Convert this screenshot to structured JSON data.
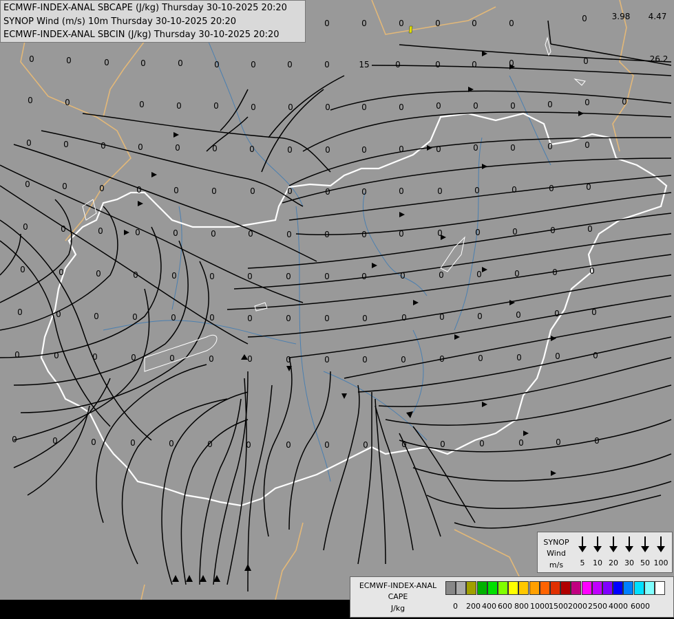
{
  "titles": {
    "line1": "ECMWF-INDEX-ANAL SBCAPE (J/kg) Thursday 30-10-2025 20:20",
    "line2": "SYNOP Wind (m/s) 10m Thursday 30-10-2025 20:20",
    "line3": "ECMWF-INDEX-ANAL SBCIN (J/kg) Thursday 30-10-2025 20:20"
  },
  "synop_legend": {
    "title1": "SYNOP",
    "title2": "Wind",
    "title3": "m/s",
    "values": [
      "5",
      "10",
      "20",
      "30",
      "50",
      "100"
    ]
  },
  "cape_legend": {
    "title1": "ECMWF-INDEX-ANAL",
    "title2": "CAPE",
    "title3": "J/kg",
    "ticks": [
      "0",
      "200",
      "400",
      "600",
      "800",
      "1000",
      "1500",
      "2000",
      "2500",
      "4000",
      "6000"
    ],
    "colors": [
      "#888888",
      "#aaaaaa",
      "#a0a000",
      "#00b000",
      "#00e000",
      "#80ff00",
      "#ffff00",
      "#ffc800",
      "#ffa000",
      "#ff6400",
      "#e03000",
      "#b00000",
      "#c00080",
      "#ff00ff",
      "#c000ff",
      "#8000ff",
      "#0000ff",
      "#0080ff",
      "#00e0ff",
      "#80ffff",
      "#ffffff"
    ]
  },
  "map_values": [
    "0",
    "0",
    "0",
    "0",
    "0",
    "0",
    "0",
    "3.98",
    "4.47",
    "0",
    "0",
    "0",
    "0",
    "0",
    "0",
    "0",
    "0",
    "0",
    "15",
    "0",
    "0",
    "0",
    "0",
    "0",
    "26.2",
    "0",
    "0",
    "0",
    "0",
    "0",
    "0",
    "0",
    "0",
    "0",
    "0",
    "0",
    "0",
    "0",
    "0",
    "0",
    "0",
    "0",
    "0",
    "0",
    "0",
    "0",
    "0",
    "0",
    "0",
    "0",
    "0",
    "0",
    "0",
    "0",
    "0",
    "0",
    "0",
    "0",
    "0",
    "0",
    "0",
    "0",
    "0",
    "0",
    "0",
    "0",
    "0",
    "0",
    "0",
    "0",
    "0",
    "0",
    "0",
    "0",
    "0",
    "0",
    "0",
    "0",
    "0",
    "0",
    "0",
    "0",
    "0",
    "0",
    "0",
    "0",
    "0",
    "0",
    "0",
    "0",
    "0",
    "0",
    "0",
    "0",
    "0",
    "0",
    "0",
    "0",
    "0",
    "0",
    "0",
    "0",
    "0",
    "0",
    "0",
    "0",
    "0",
    "0",
    "0",
    "0",
    "0",
    "0",
    "0",
    "0",
    "0",
    "0",
    "0",
    "0",
    "0",
    "0",
    "0",
    "0",
    "0",
    "0",
    "0",
    "0",
    "0",
    "0",
    "0",
    "0",
    "0",
    "0",
    "0",
    "0",
    "0",
    "0",
    "0",
    "0",
    "0",
    "0",
    "0",
    "0",
    "0",
    "0",
    "0",
    "0",
    "0",
    "0",
    "0",
    "0",
    "0",
    "0",
    "0"
  ],
  "colors": {
    "background": "#999999",
    "streamline": "#000000",
    "border": "#ffffff",
    "coast": "#e3b878",
    "river": "#4a7fb0"
  }
}
